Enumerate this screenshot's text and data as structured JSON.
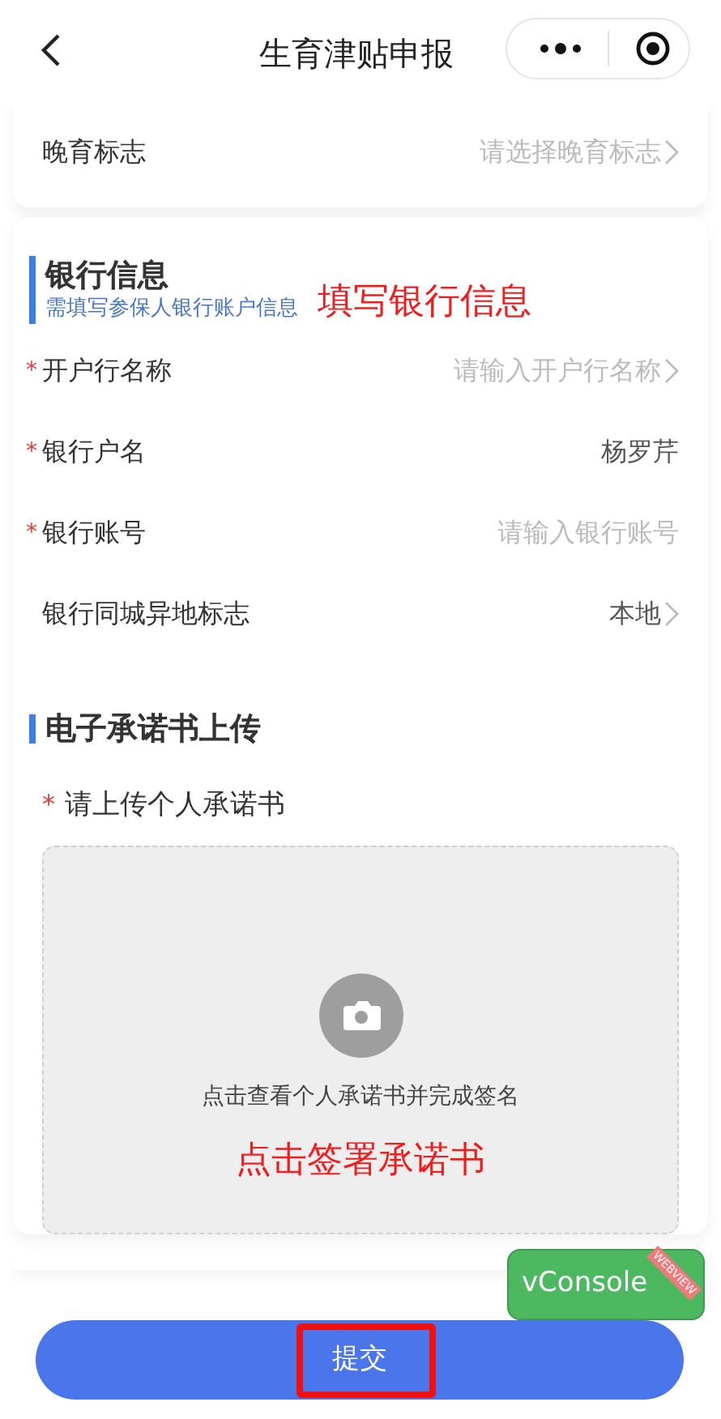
{
  "nav": {
    "title": "生育津贴申报"
  },
  "top_row": {
    "label": "晚育标志",
    "placeholder": "请选择晚育标志",
    "chevron": true
  },
  "bank": {
    "title": "银行信息",
    "subtitle": "需填写参保人银行账户信息",
    "annotation": "填写银行信息",
    "rows": [
      {
        "label": "开户行名称",
        "required_mark": "*",
        "placeholder": "请输入开户行名称",
        "chevron": true
      },
      {
        "label": "银行户名",
        "required_mark": "*",
        "value": "杨罗芹",
        "chevron": false
      },
      {
        "label": "银行账号",
        "required_mark": "*",
        "placeholder": "请输入银行账号",
        "chevron": false
      },
      {
        "label": "银行同城异地标志",
        "value": "本地",
        "chevron": true
      }
    ]
  },
  "upload": {
    "title": "电子承诺书上传",
    "label": "请上传个人承诺书",
    "required_mark": "*",
    "hint": "点击查看个人承诺书并完成签名",
    "annotation": "点击签署承诺书"
  },
  "vconsole": {
    "label": "vConsole",
    "ribbon": "WEBVIEW"
  },
  "submit": {
    "label": "提交",
    "highlighted": true
  }
}
